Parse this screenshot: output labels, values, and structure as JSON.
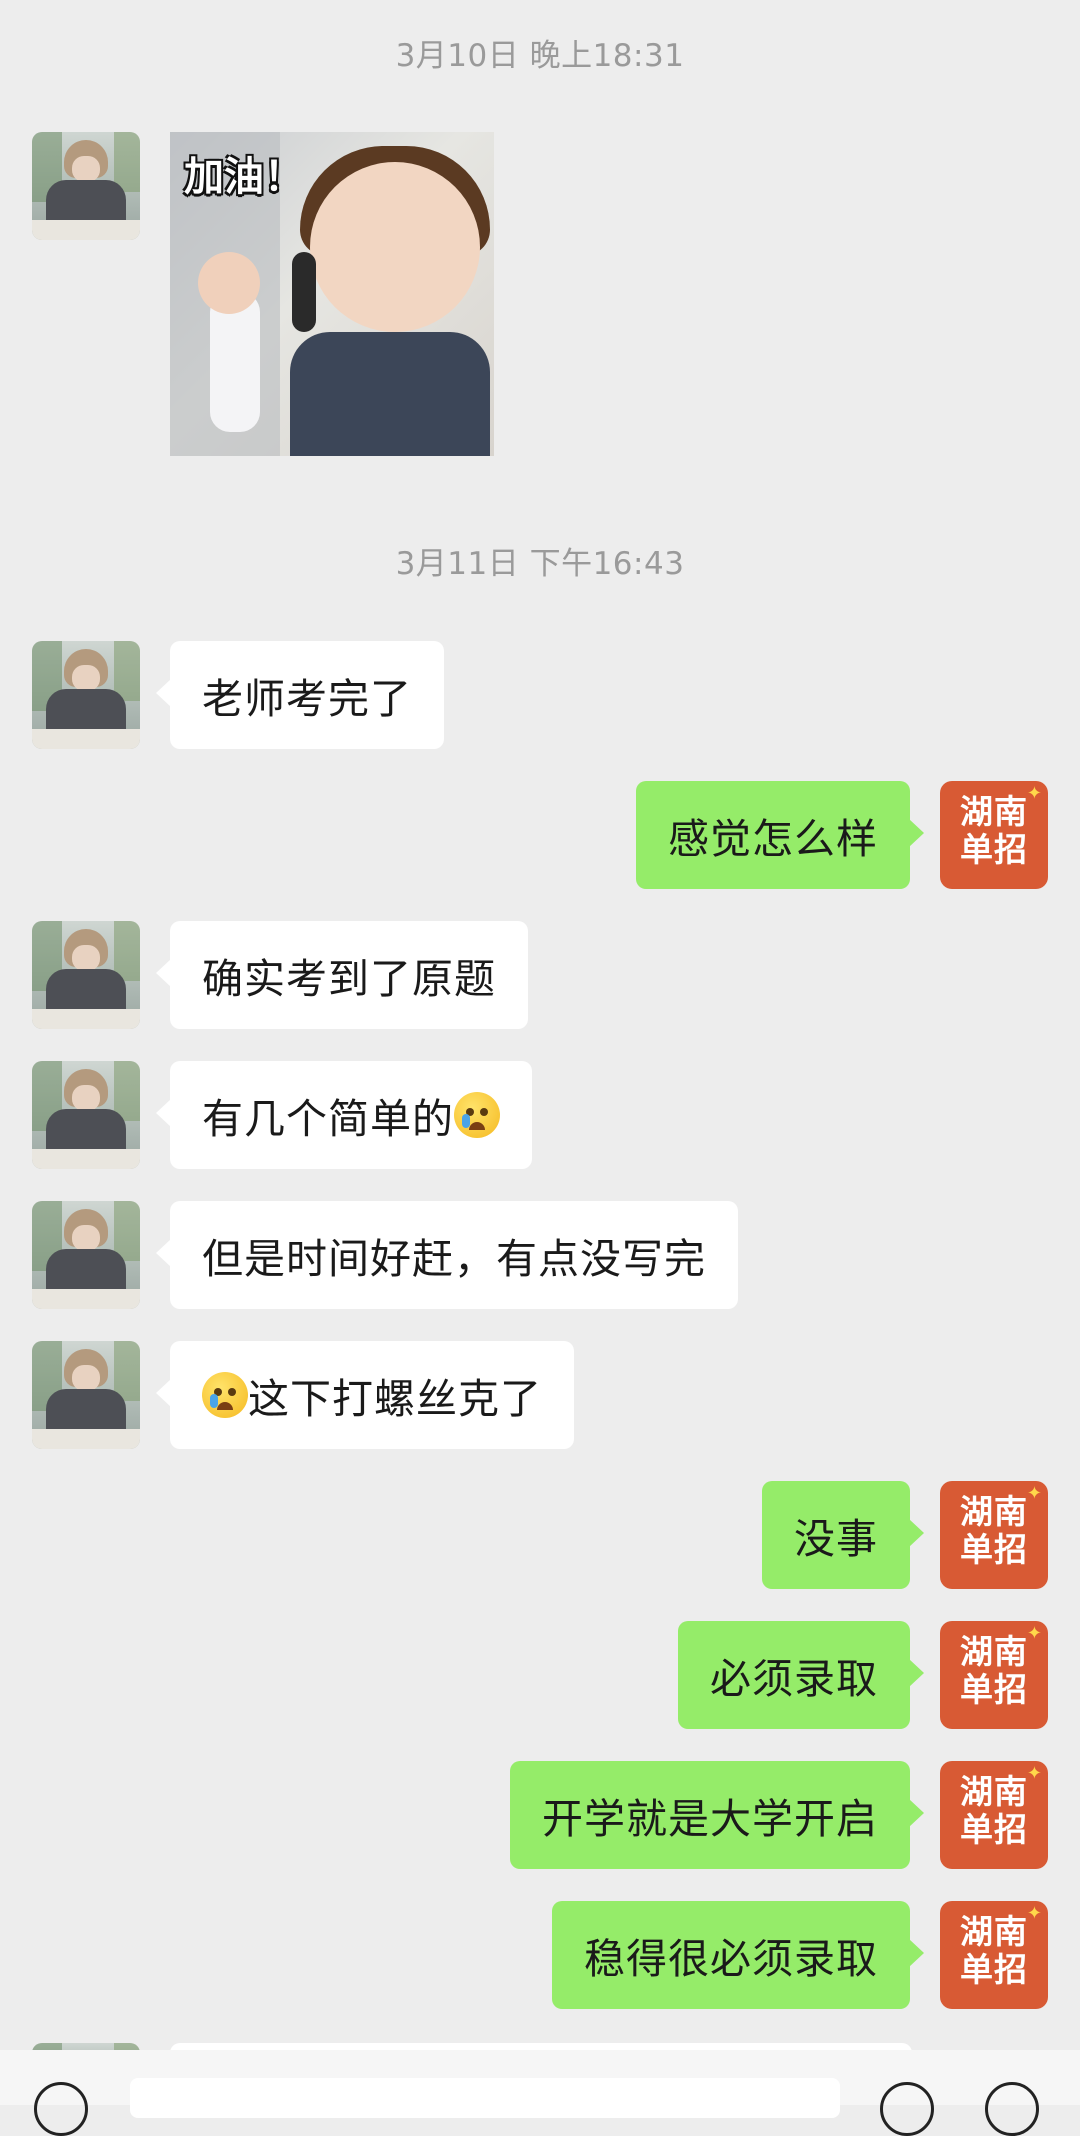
{
  "timestamps": [
    "3月10日 晚上18:31",
    "3月11日 下午16:43"
  ],
  "sticker_caption": "加油！",
  "contact_logo": "湖南\n单招",
  "messages": [
    {
      "side": "left",
      "text": "老师考完了"
    },
    {
      "side": "right",
      "text": "感觉怎么样"
    },
    {
      "side": "left",
      "text": "确实考到了原题"
    },
    {
      "side": "left",
      "text": "有几个简单的",
      "emoji_after": "laugh-cry-emoji"
    },
    {
      "side": "left",
      "text": "但是时间好赶，有点没写完"
    },
    {
      "side": "left",
      "text": "这下打螺丝克了",
      "emoji_before": "crying-emoji"
    },
    {
      "side": "right",
      "text": "没事"
    },
    {
      "side": "right",
      "text": "必须录取"
    },
    {
      "side": "right",
      "text": "开学就是大学开启"
    },
    {
      "side": "right",
      "text": "稳得很必须录取"
    }
  ],
  "colors": {
    "background": "#ededed",
    "sent_bubble": "#95ec69",
    "received_bubble": "#ffffff",
    "logo_bg": "#d85a34"
  }
}
